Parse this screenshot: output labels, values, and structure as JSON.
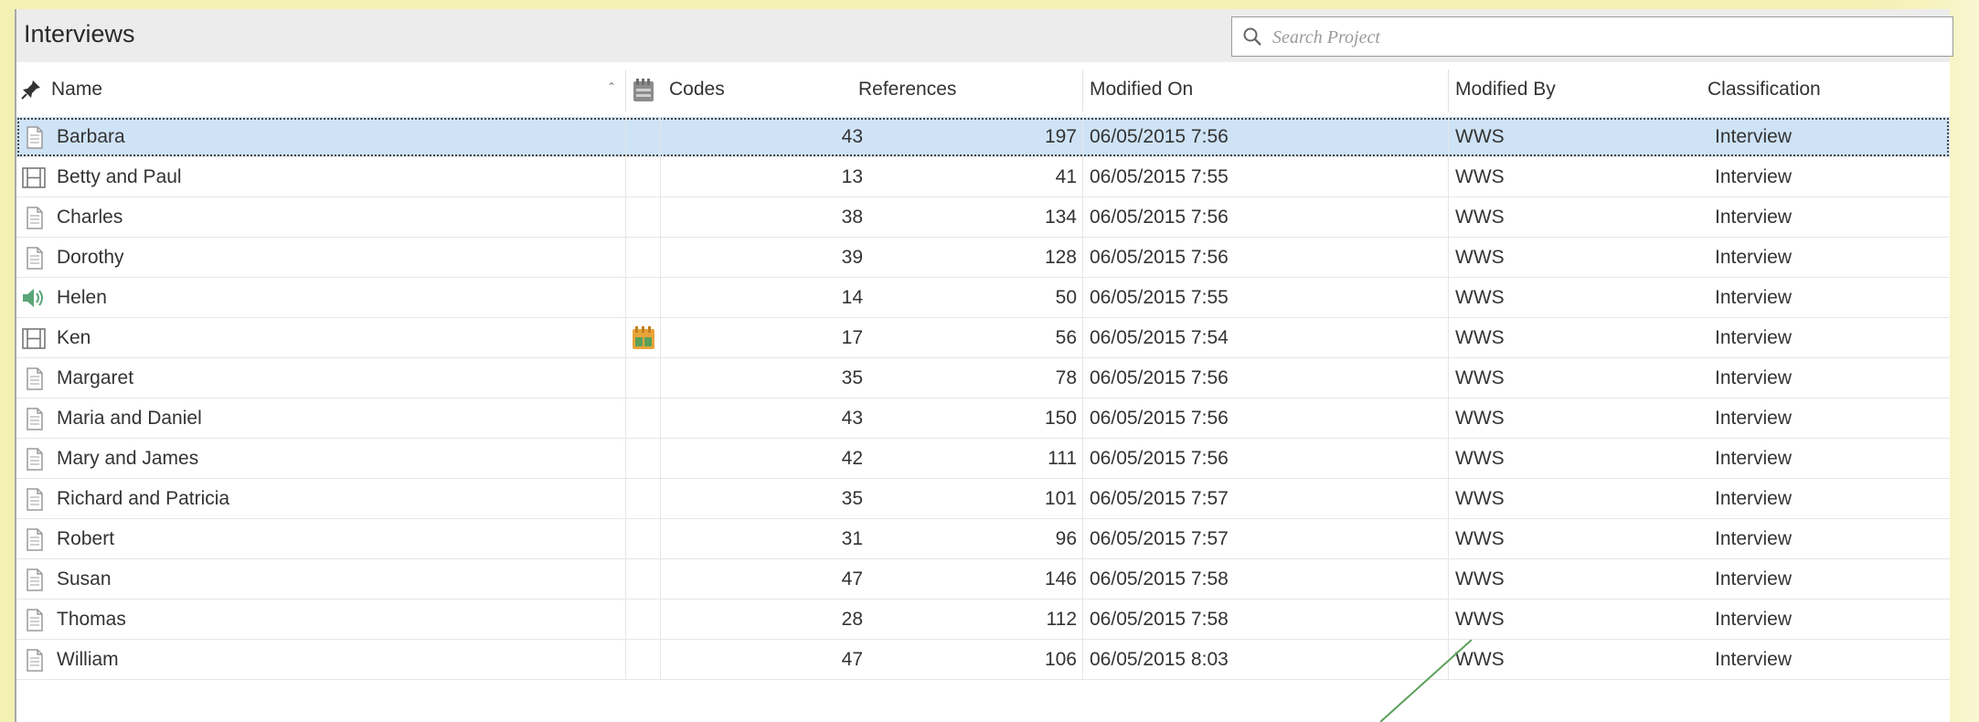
{
  "panel": {
    "title": "Interviews",
    "search": {
      "placeholder": "Search Project"
    }
  },
  "columns": {
    "name": "Name",
    "codes": "Codes",
    "references": "References",
    "modified_on": "Modified On",
    "modified_by": "Modified By",
    "classification": "Classification"
  },
  "rows": [
    {
      "icon": "document-icon",
      "name": "Barbara",
      "codes": "43",
      "references": "197",
      "modified_on": "06/05/2015 7:56",
      "modified_by": "WWS",
      "classification": "Interview",
      "selected": true
    },
    {
      "icon": "video-icon",
      "name": "Betty and Paul",
      "codes": "13",
      "references": "41",
      "modified_on": "06/05/2015 7:55",
      "modified_by": "WWS",
      "classification": "Interview"
    },
    {
      "icon": "document-icon",
      "name": "Charles",
      "codes": "38",
      "references": "134",
      "modified_on": "06/05/2015 7:56",
      "modified_by": "WWS",
      "classification": "Interview"
    },
    {
      "icon": "document-icon",
      "name": "Dorothy",
      "codes": "39",
      "references": "128",
      "modified_on": "06/05/2015 7:56",
      "modified_by": "WWS",
      "classification": "Interview"
    },
    {
      "icon": "audio-icon",
      "name": "Helen",
      "codes": "14",
      "references": "50",
      "modified_on": "06/05/2015 7:55",
      "modified_by": "WWS",
      "classification": "Interview"
    },
    {
      "icon": "video-icon",
      "name": "Ken",
      "codes": "17",
      "references": "56",
      "modified_on": "06/05/2015 7:54",
      "modified_by": "WWS",
      "classification": "Interview",
      "coded_flag": true
    },
    {
      "icon": "document-icon",
      "name": "Margaret",
      "codes": "35",
      "references": "78",
      "modified_on": "06/05/2015 7:56",
      "modified_by": "WWS",
      "classification": "Interview"
    },
    {
      "icon": "document-icon",
      "name": "Maria and Daniel",
      "codes": "43",
      "references": "150",
      "modified_on": "06/05/2015 7:56",
      "modified_by": "WWS",
      "classification": "Interview"
    },
    {
      "icon": "document-icon",
      "name": "Mary and James",
      "codes": "42",
      "references": "111",
      "modified_on": "06/05/2015 7:56",
      "modified_by": "WWS",
      "classification": "Interview"
    },
    {
      "icon": "document-icon",
      "name": "Richard and Patricia",
      "codes": "35",
      "references": "101",
      "modified_on": "06/05/2015 7:57",
      "modified_by": "WWS",
      "classification": "Interview"
    },
    {
      "icon": "document-icon",
      "name": "Robert",
      "codes": "31",
      "references": "96",
      "modified_on": "06/05/2015 7:57",
      "modified_by": "WWS",
      "classification": "Interview"
    },
    {
      "icon": "document-icon",
      "name": "Susan",
      "codes": "47",
      "references": "146",
      "modified_on": "06/05/2015 7:58",
      "modified_by": "WWS",
      "classification": "Interview"
    },
    {
      "icon": "document-icon",
      "name": "Thomas",
      "codes": "28",
      "references": "112",
      "modified_on": "06/05/2015 7:58",
      "modified_by": "WWS",
      "classification": "Interview"
    },
    {
      "icon": "document-icon",
      "name": "William",
      "codes": "47",
      "references": "106",
      "modified_on": "06/05/2015 8:03",
      "modified_by": "WWS",
      "classification": "Interview"
    }
  ],
  "colors": {
    "background": "#f3f0b4",
    "selected_row": "#cfe3f6",
    "connector": "#5aa05a"
  }
}
